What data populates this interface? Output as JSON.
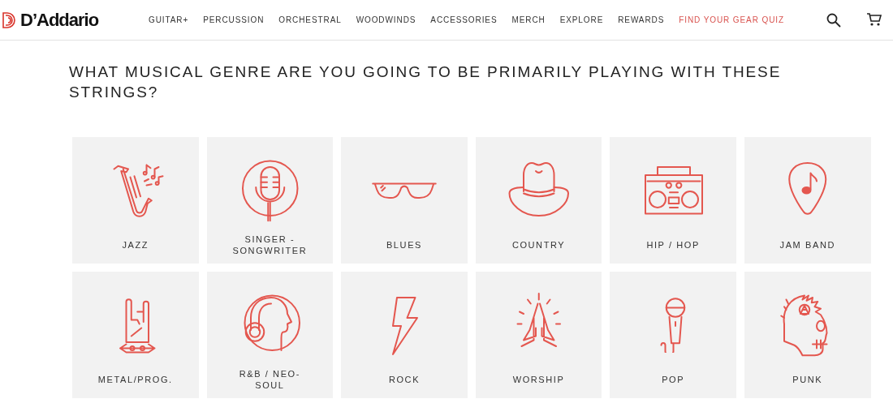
{
  "header": {
    "logo": "D’Addario",
    "nav": [
      {
        "label": "GUITAR+",
        "selected": false
      },
      {
        "label": "PERCUSSION",
        "selected": false
      },
      {
        "label": "ORCHESTRAL",
        "selected": false
      },
      {
        "label": "WOODWINDS",
        "selected": false
      },
      {
        "label": "ACCESSORIES",
        "selected": false
      },
      {
        "label": "MERCH",
        "selected": false
      },
      {
        "label": "EXPLORE",
        "selected": false
      },
      {
        "label": "REWARDS",
        "selected": false
      },
      {
        "label": "FIND YOUR GEAR QUIZ",
        "selected": true
      }
    ]
  },
  "question": "WHAT MUSICAL GENRE ARE YOU GOING TO BE PRIMARILY PLAYING WITH THESE STRINGS?",
  "genres": [
    {
      "label": "JAZZ"
    },
    {
      "label": "SINGER - SONGWRITER"
    },
    {
      "label": "BLUES"
    },
    {
      "label": "COUNTRY"
    },
    {
      "label": "HIP / HOP"
    },
    {
      "label": "JAM BAND"
    },
    {
      "label": "METAL/PROG."
    },
    {
      "label": "R&B / NEO-SOUL"
    },
    {
      "label": "ROCK"
    },
    {
      "label": "WORSHIP"
    },
    {
      "label": "POP"
    },
    {
      "label": "PUNK"
    }
  ]
}
